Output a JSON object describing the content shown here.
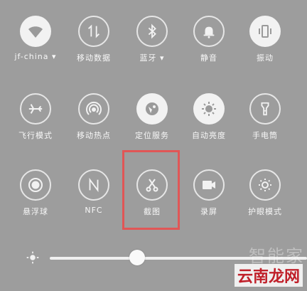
{
  "tiles": [
    {
      "label": "jf-china ▾",
      "state": "on",
      "icon": "wifi-icon"
    },
    {
      "label": "移动数据",
      "state": "off",
      "icon": "mobile-data-icon"
    },
    {
      "label": "蓝牙 ▾",
      "state": "off",
      "icon": "bluetooth-icon"
    },
    {
      "label": "静音",
      "state": "off",
      "icon": "bell-icon"
    },
    {
      "label": "振动",
      "state": "on",
      "icon": "vibrate-icon"
    },
    {
      "label": "飞行模式",
      "state": "off",
      "icon": "airplane-icon"
    },
    {
      "label": "移动热点",
      "state": "off",
      "icon": "hotspot-icon"
    },
    {
      "label": "定位服务",
      "state": "on",
      "icon": "location-icon"
    },
    {
      "label": "自动亮度",
      "state": "on",
      "icon": "auto-brightness-icon"
    },
    {
      "label": "手电筒",
      "state": "off",
      "icon": "flashlight-icon"
    },
    {
      "label": "悬浮球",
      "state": "off",
      "icon": "floating-ball-icon"
    },
    {
      "label": "NFC",
      "state": "off",
      "icon": "nfc-icon"
    },
    {
      "label": "截图",
      "state": "off",
      "icon": "scissors-icon"
    },
    {
      "label": "录屏",
      "state": "off",
      "icon": "screen-record-icon"
    },
    {
      "label": "护眼模式",
      "state": "off",
      "icon": "eye-comfort-icon"
    }
  ],
  "brightness": {
    "level": 0.34,
    "icon": "brightness-icon"
  },
  "watermarks": {
    "faded": "智能家",
    "main": "云南龙网"
  },
  "colors": {
    "highlight": "#e15656",
    "background": "#9d9d9d"
  }
}
